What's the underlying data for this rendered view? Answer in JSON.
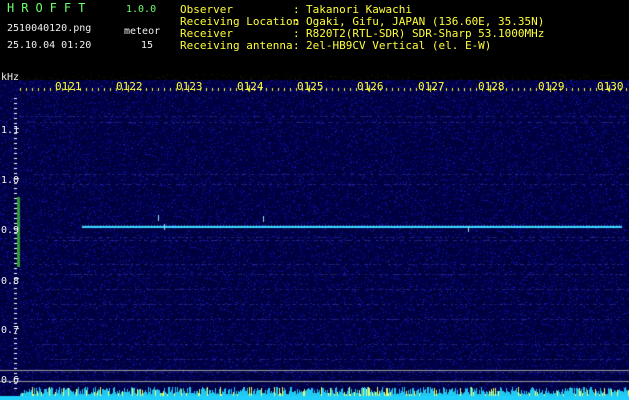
{
  "app": {
    "title": "HROFFT",
    "version": "1.0.0"
  },
  "file_name": "2510040120.png",
  "timestamp": "25.10.04 01:20",
  "meteor": {
    "label": "meteor",
    "count": "15"
  },
  "info": [
    {
      "key": "Observer",
      "value": "Takanori Kawachi"
    },
    {
      "key": "Receiving Location",
      "value": "Ogaki, Gifu, JAPAN (136.60E, 35.35N)"
    },
    {
      "key": "Receiver",
      "value": "R820T2(RTL-SDR) SDR-Sharp 53.1000MHz"
    },
    {
      "key": "Receiving antenna",
      "value": "2el-HB9CV Vertical (el. E-W)"
    }
  ],
  "info_separator": ":",
  "axis": {
    "y_unit": "kHz",
    "x_ticks": [
      "0121",
      "0122",
      "0123",
      "0124",
      "0125",
      "0126",
      "0127",
      "0128",
      "0129",
      "0130"
    ],
    "y_ticks": [
      "1.1",
      "1.0",
      "0.9",
      "0.8",
      "0.7",
      "0.6"
    ]
  },
  "colors": {
    "title_green": "#6dff6d",
    "tick_yellow": "#ffff3a",
    "background": "#000000",
    "signal_cyan": "#3ad8ff",
    "noise_blue": "#14146e"
  }
}
